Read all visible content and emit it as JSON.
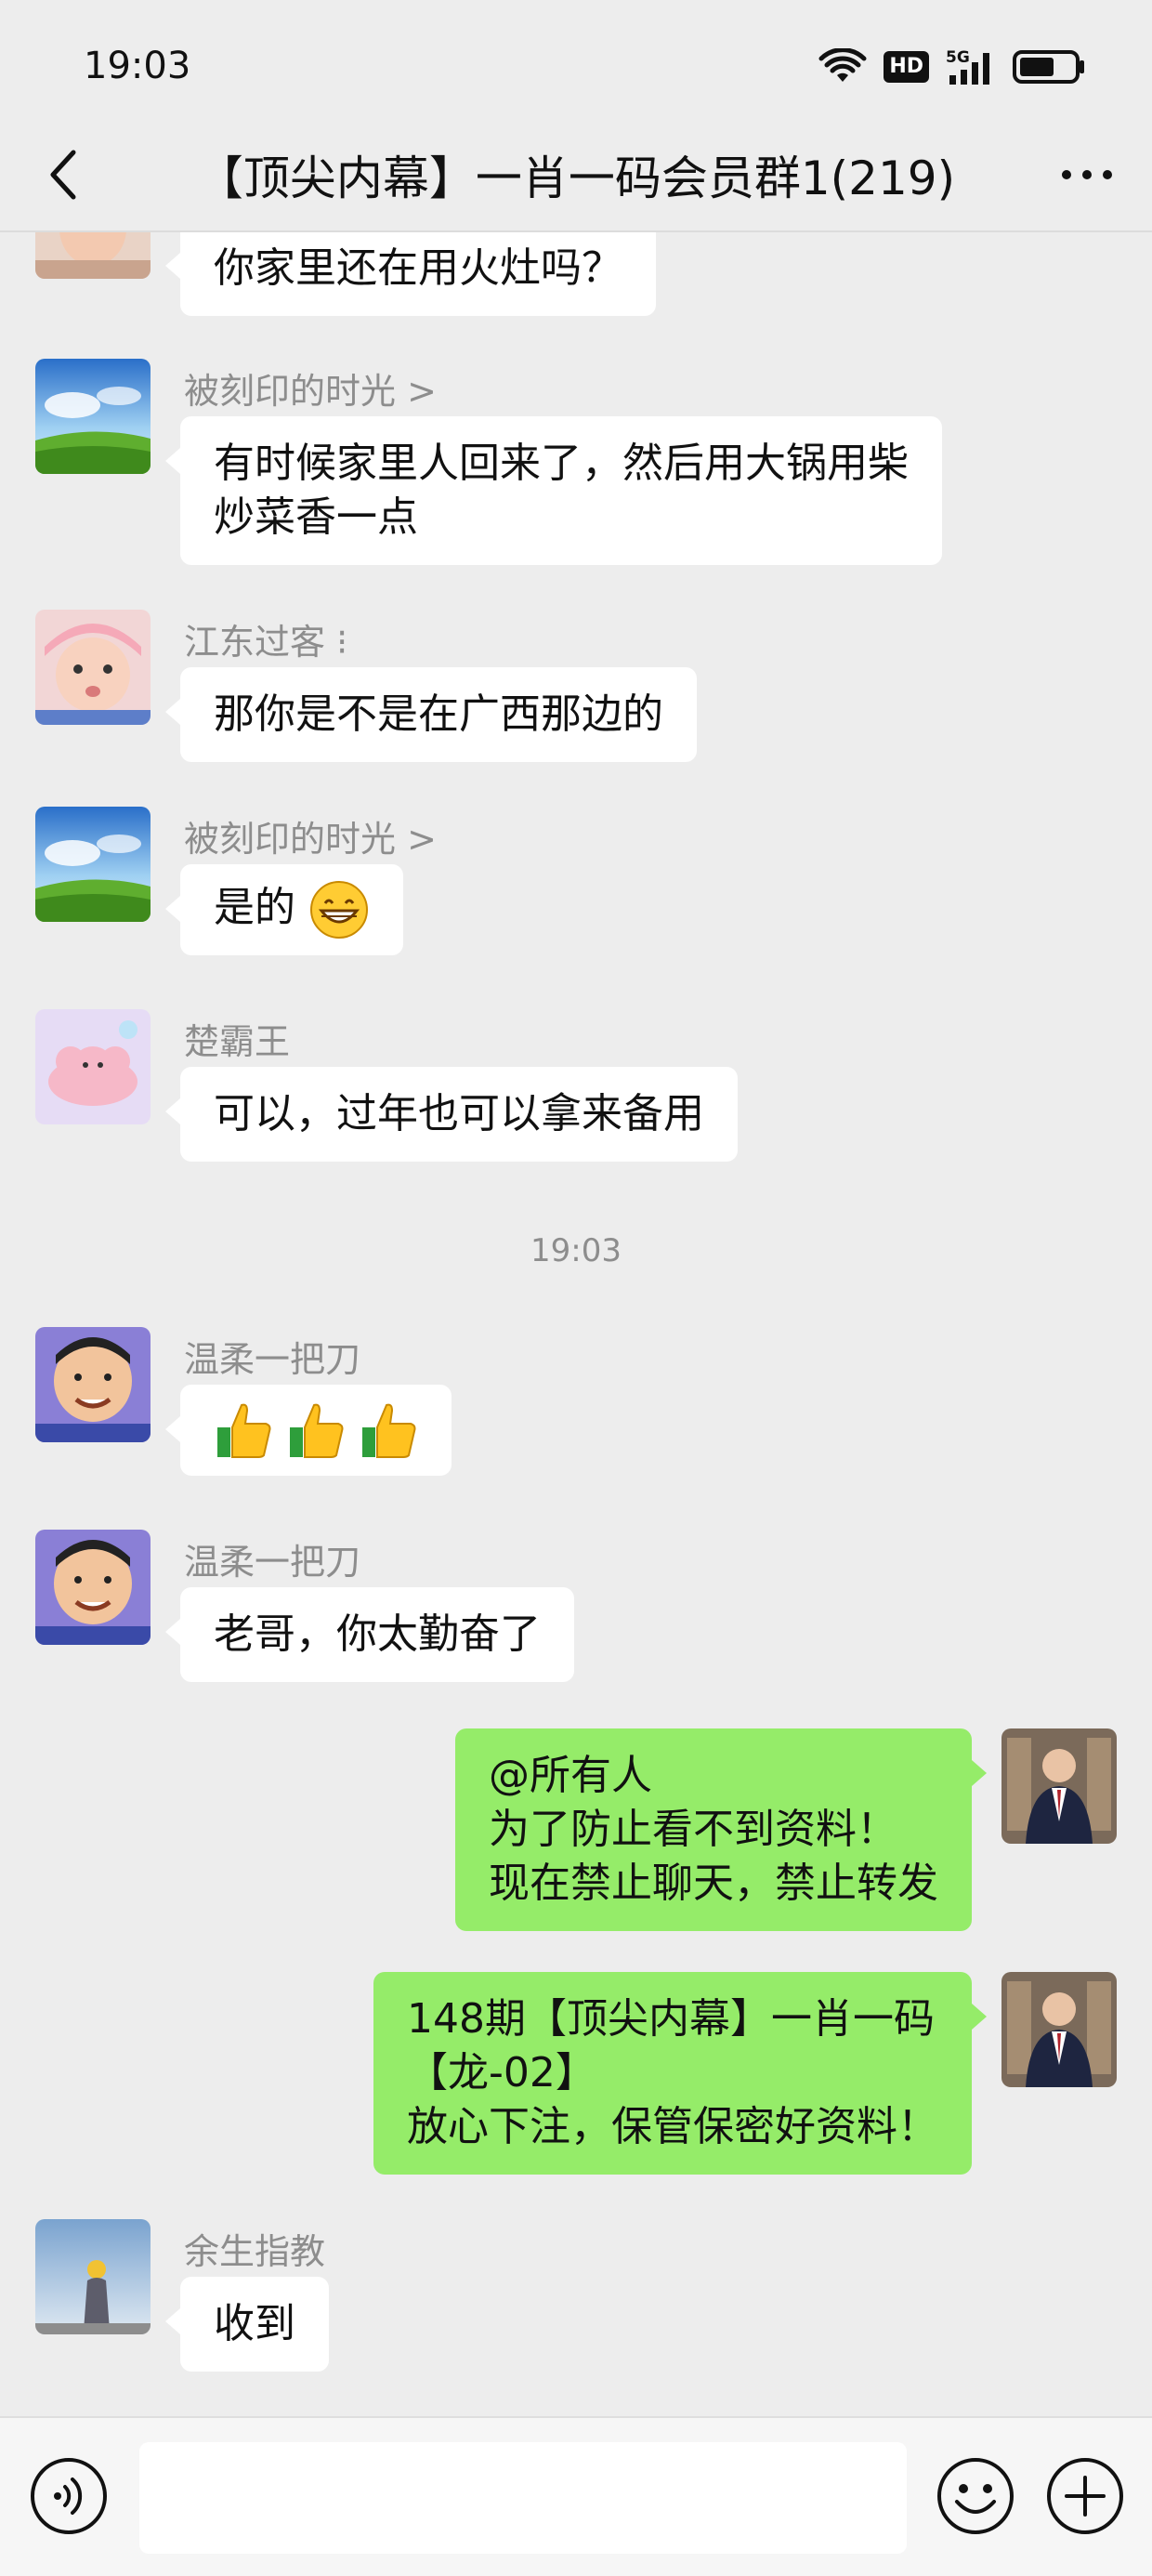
{
  "status_bar": {
    "time": "19:03",
    "network": "5G",
    "hd": "HD",
    "icons": [
      "wifi-icon",
      "hd-icon",
      "signal-5g-icon",
      "battery-icon"
    ]
  },
  "header": {
    "title": "【顶尖内幕】一肖一码会员群1(219)",
    "back_icon": "chevron-left-icon",
    "more_icon": "more-dots-icon"
  },
  "messages": [
    {
      "sender": "",
      "text": "你家里还在用火灶吗？",
      "side": "left"
    },
    {
      "sender": "被刻印的时光 >",
      "lines": [
        "有时候家里人回来了，然后用大锅用柴",
        "炒菜香一点"
      ],
      "side": "left"
    },
    {
      "sender": "江东过客 ⁝",
      "text": "那你是不是在广西那边的",
      "side": "left"
    },
    {
      "sender": "被刻印的时光 >",
      "text": "是的",
      "emoji": "grinning-face",
      "side": "left"
    },
    {
      "sender": "楚霸王",
      "text": "可以，过年也可以拿来备用",
      "side": "left"
    },
    {
      "sender": "温柔一把刀",
      "emoji": "thumbs-up x3",
      "side": "left"
    },
    {
      "sender": "温柔一把刀",
      "text": "老哥，你太勤奋了",
      "side": "left"
    },
    {
      "lines": [
        "@所有人",
        "为了防止看不到资料！",
        "现在禁止聊天，禁止转发"
      ],
      "side": "right"
    },
    {
      "lines": [
        "148期【顶尖内幕】一肖一码",
        "【龙-02】",
        "放心下注，保管保密好资料！"
      ],
      "side": "right"
    },
    {
      "sender": "余生指教",
      "text": "收到",
      "side": "left"
    }
  ],
  "time_separator": "19:03",
  "input_bar": {
    "voice_icon": "voice-icon",
    "emoji_icon": "emoji-icon",
    "plus_icon": "plus-icon",
    "placeholder": ""
  },
  "colors": {
    "background": "#ededed",
    "bubble_left": "#ffffff",
    "bubble_right": "#95ec69",
    "meta_text": "#8d8d8d"
  }
}
